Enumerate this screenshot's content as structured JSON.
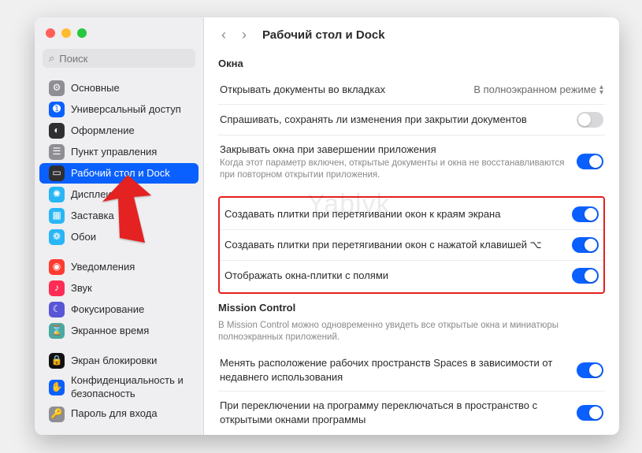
{
  "search": {
    "placeholder": "Поиск"
  },
  "sidebar": {
    "items": [
      {
        "label": "Основные",
        "iconClass": "ic-gray",
        "glyph": "⚙"
      },
      {
        "label": "Универсальный доступ",
        "iconClass": "ic-blue",
        "glyph": "➊"
      },
      {
        "label": "Оформление",
        "iconClass": "ic-dark",
        "glyph": "◐"
      },
      {
        "label": "Пункт управления",
        "iconClass": "ic-gray",
        "glyph": "☰"
      },
      {
        "label": "Рабочий стол и Dock",
        "iconClass": "ic-dark",
        "glyph": "▭",
        "selected": true
      },
      {
        "label": "Дисплеи",
        "iconClass": "ic-cyan",
        "glyph": "✺"
      },
      {
        "label": "Заставка",
        "iconClass": "ic-cyan",
        "glyph": "▦"
      },
      {
        "label": "Обои",
        "iconClass": "ic-cyan",
        "glyph": "❁"
      },
      {
        "gap": true
      },
      {
        "label": "Уведомления",
        "iconClass": "ic-red",
        "glyph": "◉"
      },
      {
        "label": "Звук",
        "iconClass": "ic-pink",
        "glyph": "♪"
      },
      {
        "label": "Фокусирование",
        "iconClass": "ic-purple",
        "glyph": "☾"
      },
      {
        "label": "Экранное время",
        "iconClass": "ic-teal",
        "glyph": "⌛"
      },
      {
        "gap": true
      },
      {
        "label": "Экран блокировки",
        "iconClass": "ic-black",
        "glyph": "🔒"
      },
      {
        "label": "Конфиденциальность и безопасность",
        "iconClass": "ic-blue",
        "glyph": "✋"
      },
      {
        "label": "Пароль для входа",
        "iconClass": "ic-gray",
        "glyph": "🔑"
      }
    ]
  },
  "header": {
    "title": "Рабочий стол и Dock"
  },
  "sections": {
    "windows": {
      "title": "Окна",
      "rows": [
        {
          "label": "Открывать документы во вкладках",
          "type": "select",
          "value": "В полноэкранном режиме"
        },
        {
          "label": "Спрашивать, сохранять ли изменения при закрытии документов",
          "type": "toggle",
          "on": false
        },
        {
          "label": "Закрывать окна при завершении приложения",
          "sub": "Когда этот параметр включен, открытые документы и окна не восстанавливаются при повторном открытии приложения.",
          "type": "toggle",
          "on": true
        }
      ]
    },
    "tiles": {
      "rows": [
        {
          "label": "Создавать плитки при перетягивании окон к краям экрана",
          "type": "toggle",
          "on": true
        },
        {
          "label": "Создавать плитки при перетягивании окон с нажатой клавишей ⌥",
          "type": "toggle",
          "on": true
        },
        {
          "label": "Отображать окна-плитки с полями",
          "type": "toggle",
          "on": true
        }
      ]
    },
    "mission": {
      "title": "Mission Control",
      "desc": "В Mission Control можно одновременно увидеть все открытые окна и миниатюры полноэкранных приложений.",
      "rows": [
        {
          "label": "Менять расположение рабочих пространств Spaces в зависимости от недавнего использования",
          "type": "toggle",
          "on": true
        },
        {
          "label": "При переключении на программу переключаться в пространство с открытыми окнами программы",
          "type": "toggle",
          "on": true
        }
      ]
    }
  },
  "watermark": "Yablyk"
}
